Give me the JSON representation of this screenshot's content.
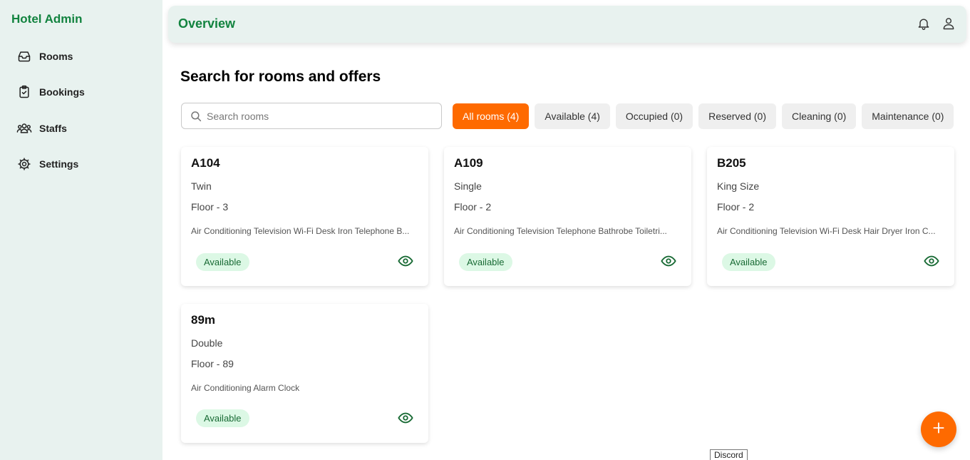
{
  "sidebar": {
    "brand": "Hotel Admin",
    "items": [
      {
        "label": "Rooms",
        "icon": "inbox-icon"
      },
      {
        "label": "Bookings",
        "icon": "clipboard-check-icon"
      },
      {
        "label": "Staffs",
        "icon": "users-icon"
      },
      {
        "label": "Settings",
        "icon": "gear-icon"
      }
    ]
  },
  "header": {
    "title": "Overview",
    "icons": [
      "bell-icon",
      "user-icon"
    ]
  },
  "main": {
    "heading": "Search for rooms and offers",
    "search": {
      "placeholder": "Search rooms",
      "value": ""
    },
    "filters": [
      {
        "label": "All rooms (4)",
        "active": true
      },
      {
        "label": "Available (4)",
        "active": false
      },
      {
        "label": "Occupied (0)",
        "active": false
      },
      {
        "label": "Reserved (0)",
        "active": false
      },
      {
        "label": "Cleaning (0)",
        "active": false
      },
      {
        "label": "Maintenance (0)",
        "active": false
      }
    ],
    "rooms": [
      {
        "code": "A104",
        "type": "Twin",
        "floor": "Floor - 3",
        "amenities": "Air Conditioning Television Wi-Fi Desk Iron Telephone B...",
        "status": "Available"
      },
      {
        "code": "A109",
        "type": "Single",
        "floor": "Floor - 2",
        "amenities": "Air Conditioning Television Telephone Bathrobe Toiletri...",
        "status": "Available"
      },
      {
        "code": "B205",
        "type": "King Size",
        "floor": "Floor - 2",
        "amenities": "Air Conditioning Television Wi-Fi Desk Hair Dryer Iron C...",
        "status": "Available"
      },
      {
        "code": "89m",
        "type": "Double",
        "floor": "Floor - 89",
        "amenities": "Air Conditioning Alarm Clock",
        "status": "Available"
      }
    ]
  },
  "tooltip": "Discord",
  "colors": {
    "accent": "#fe6a00",
    "brand_green": "#12833f",
    "sidebar_bg": "#e8f2ef",
    "badge_bg": "#dcf8e5",
    "badge_text": "#186a34"
  }
}
